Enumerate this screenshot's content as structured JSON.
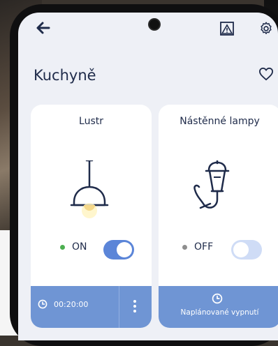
{
  "header": {
    "title": "Kuchyně"
  },
  "cards": [
    {
      "name": "Lustr",
      "status": "ON",
      "status_color": "#4caf50",
      "toggle_on": true,
      "timer": "00:20:00"
    },
    {
      "name": "Nástěnné lampy",
      "status": "OFF",
      "status_color": "#8e8e8e",
      "toggle_on": false,
      "schedule_label": "Naplánované vypnutí"
    }
  ],
  "colors": {
    "primary": "#1f2b4a",
    "accent": "#5b85d8",
    "footer": "#6f95d4",
    "toggle_off": "#cfdcf6"
  },
  "icons": {
    "back": "back-arrow-icon",
    "alert": "alert-image-icon",
    "settings": "gear-icon",
    "favorite": "heart-icon",
    "timer": "clock-icon",
    "more": "more-vertical-icon"
  }
}
